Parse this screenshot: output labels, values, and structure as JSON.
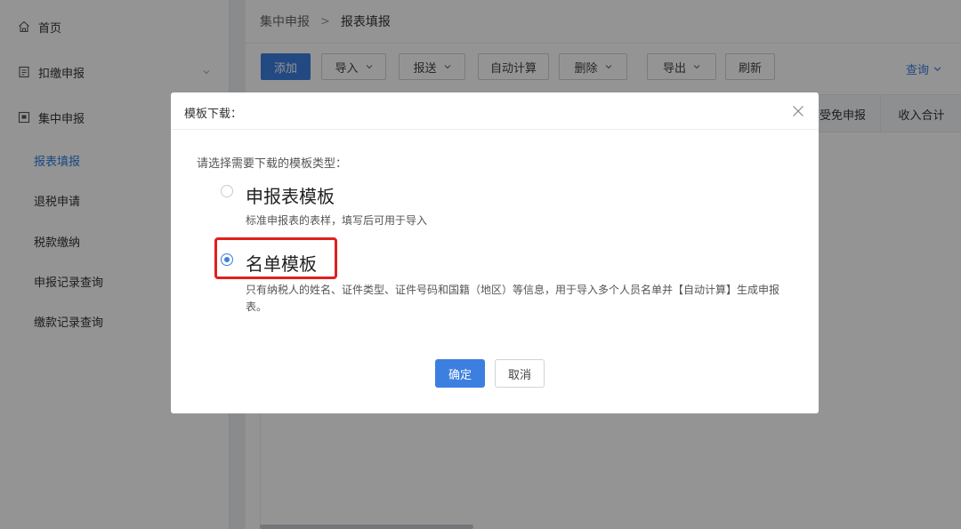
{
  "sidebar": {
    "items": [
      {
        "label": "首页",
        "icon": "home-icon"
      },
      {
        "label": "扣缴申报",
        "icon": "form-icon"
      },
      {
        "label": "集中申报",
        "icon": "monitor-icon"
      }
    ],
    "sub_items": [
      {
        "label": "报表填报",
        "active": true
      },
      {
        "label": "退税申请",
        "active": false
      },
      {
        "label": "税款缴纳",
        "active": false
      },
      {
        "label": "申报记录查询",
        "active": false
      },
      {
        "label": "缴款记录查询",
        "active": false
      }
    ]
  },
  "breadcrumb": {
    "parent": "集中申报",
    "separator": ">",
    "current": "报表填报"
  },
  "toolbar": {
    "add": "添加",
    "import": "导入",
    "submit": "报送",
    "auto_calc": "自动计算",
    "delete": "删除",
    "export": "导出",
    "refresh": "刷新",
    "query": "查询"
  },
  "table": {
    "headers": [
      "享受免申报",
      "收入合计"
    ]
  },
  "modal": {
    "title": "模板下载：",
    "prompt": "请选择需要下载的模板类型：",
    "options": [
      {
        "title": "申报表模板",
        "desc": "标准申报表的表样，填写后可用于导入",
        "selected": false
      },
      {
        "title": "名单模板",
        "desc": "只有纳税人的姓名、证件类型、证件号码和国籍（地区）等信息，用于导入多个人员名单并【自动计算】生成申报表。",
        "selected": true
      }
    ],
    "confirm": "确定",
    "cancel": "取消"
  },
  "colors": {
    "primary": "#3d7fe0",
    "highlight": "#e0201e",
    "active_menu": "#2a7de1"
  }
}
